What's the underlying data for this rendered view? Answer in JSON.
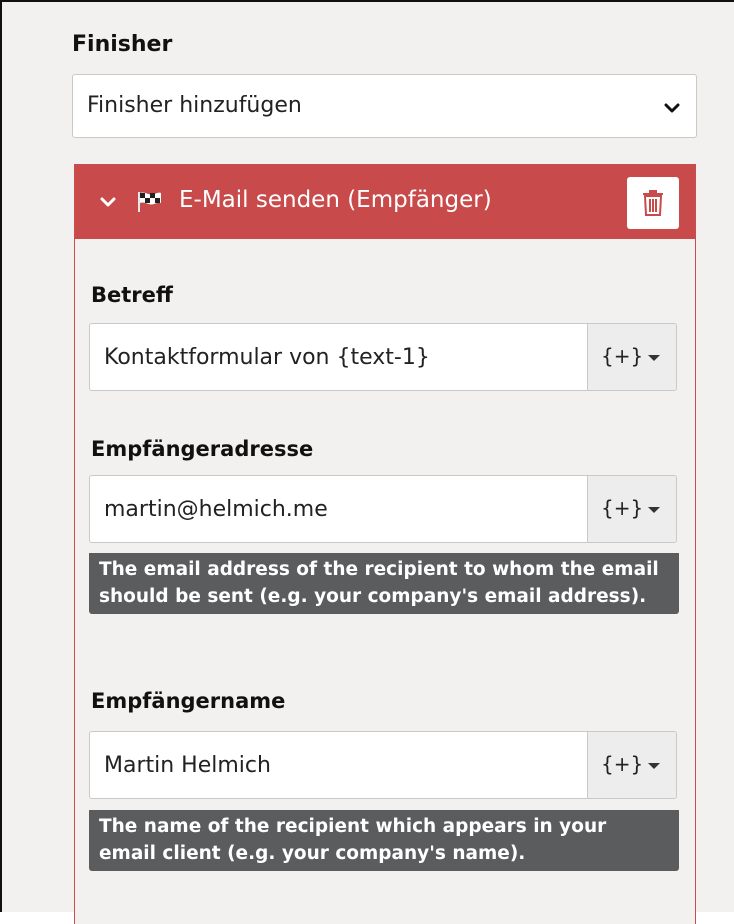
{
  "section": {
    "title": "Finisher",
    "select_label": "Finisher hinzufügen"
  },
  "finisher": {
    "title": "E-Mail senden (Empfänger)",
    "fields": {
      "subject": {
        "label": "Betreff",
        "value": "Kontaktformular von {text-1}",
        "addon": "{+}"
      },
      "recipient_address": {
        "label": "Empfängeradresse",
        "value": "martin@helmich.me",
        "addon": "{+}",
        "help": "The email address of the recipient to whom the email should be sent (e.g. your company's email address)."
      },
      "recipient_name": {
        "label": "Empfängername",
        "value": "Martin Helmich",
        "addon": "{+}",
        "help": "The name of the recipient which appears in your email client (e.g. your company's name)."
      }
    }
  },
  "icons": {
    "chevron": "chevron-down-icon",
    "flag": "checkered-flag-icon",
    "delete": "trash-icon",
    "caret": "caret-down-icon"
  },
  "colors": {
    "header_red": "#c94a4a",
    "panel_bg": "#f3f1ef",
    "help_bg": "#5b5c5d"
  }
}
